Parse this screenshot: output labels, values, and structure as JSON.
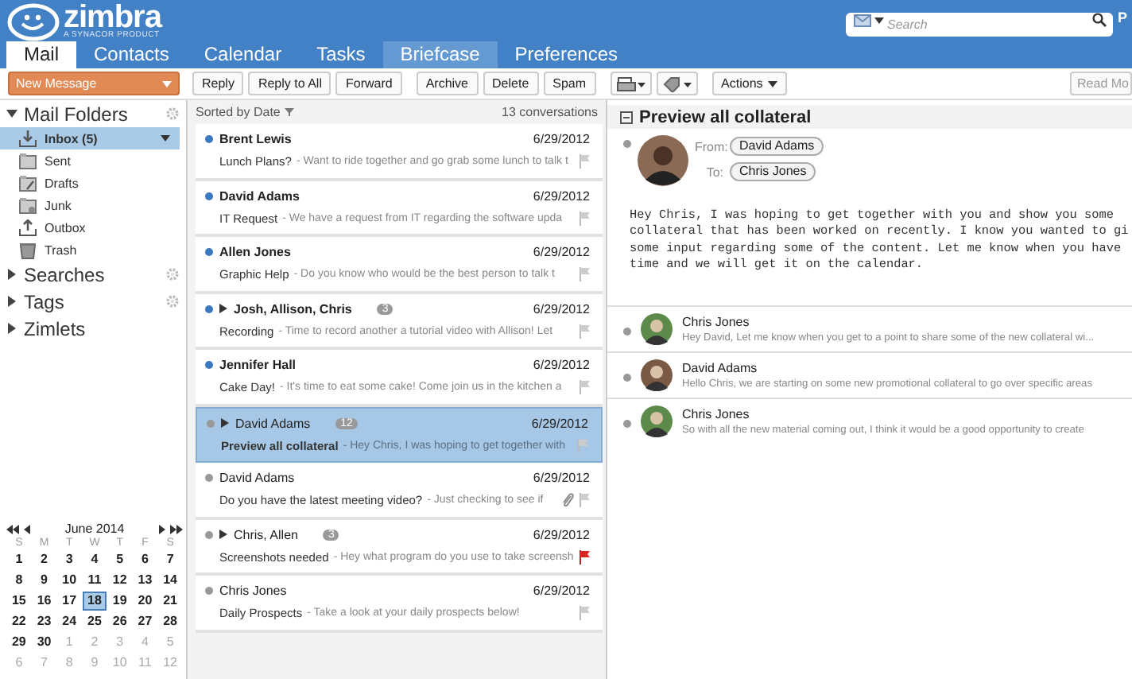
{
  "header": {
    "logo_name": "zimbra",
    "logo_tagline": "A SYNACOR PRODUCT",
    "search": {
      "placeholder": "Search"
    },
    "user_initial": "P"
  },
  "tabs": [
    {
      "label": "Mail",
      "selected": true,
      "hovered": false
    },
    {
      "label": "Contacts",
      "selected": false,
      "hovered": false
    },
    {
      "label": "Calendar",
      "selected": false,
      "hovered": false
    },
    {
      "label": "Tasks",
      "selected": false,
      "hovered": false
    },
    {
      "label": "Briefcase",
      "selected": false,
      "hovered": true
    },
    {
      "label": "Preferences",
      "selected": false,
      "hovered": false
    }
  ],
  "toolbar": {
    "new_message": "New Message",
    "groups": [
      [
        "Reply",
        "Reply to All",
        "Forward"
      ],
      [
        "Archive",
        "Delete",
        "Spam"
      ]
    ],
    "actions": "Actions",
    "read_more": "Read Mo"
  },
  "sidebar": {
    "sections": [
      {
        "label": "Mail Folders",
        "expanded": true,
        "settings": true,
        "items": [
          {
            "label": "Inbox (5)",
            "kind": "inbox",
            "selected": true,
            "unread": true
          },
          {
            "label": "Sent",
            "kind": "sent",
            "selected": false,
            "unread": false
          },
          {
            "label": "Drafts",
            "kind": "drafts",
            "selected": false,
            "unread": false
          },
          {
            "label": "Junk",
            "kind": "junk",
            "selected": false,
            "unread": false
          },
          {
            "label": "Outbox",
            "kind": "outbox",
            "selected": false,
            "unread": false
          },
          {
            "label": "Trash",
            "kind": "trash",
            "selected": false,
            "unread": false
          }
        ]
      },
      {
        "label": "Searches",
        "expanded": false,
        "settings": true
      },
      {
        "label": "Tags",
        "expanded": false,
        "settings": true
      },
      {
        "label": "Zimlets",
        "expanded": false,
        "settings": false
      }
    ]
  },
  "calendar": {
    "month": "June 2014",
    "weekdays": [
      "S",
      "M",
      "T",
      "W",
      "T",
      "F",
      "S"
    ],
    "days": [
      {
        "d": "1",
        "outside": false,
        "selected": false
      },
      {
        "d": "2",
        "outside": false,
        "selected": false
      },
      {
        "d": "3",
        "outside": false,
        "selected": false
      },
      {
        "d": "4",
        "outside": false,
        "selected": false
      },
      {
        "d": "5",
        "outside": false,
        "selected": false
      },
      {
        "d": "6",
        "outside": false,
        "selected": false
      },
      {
        "d": "7",
        "outside": false,
        "selected": false
      },
      {
        "d": "8",
        "outside": false,
        "selected": false
      },
      {
        "d": "9",
        "outside": false,
        "selected": false
      },
      {
        "d": "10",
        "outside": false,
        "selected": false
      },
      {
        "d": "11",
        "outside": false,
        "selected": false
      },
      {
        "d": "12",
        "outside": false,
        "selected": false
      },
      {
        "d": "13",
        "outside": false,
        "selected": false
      },
      {
        "d": "14",
        "outside": false,
        "selected": false
      },
      {
        "d": "15",
        "outside": false,
        "selected": false
      },
      {
        "d": "16",
        "outside": false,
        "selected": false
      },
      {
        "d": "17",
        "outside": false,
        "selected": false
      },
      {
        "d": "18",
        "outside": false,
        "selected": true
      },
      {
        "d": "19",
        "outside": false,
        "selected": false
      },
      {
        "d": "20",
        "outside": false,
        "selected": false
      },
      {
        "d": "21",
        "outside": false,
        "selected": false
      },
      {
        "d": "22",
        "outside": false,
        "selected": false
      },
      {
        "d": "23",
        "outside": false,
        "selected": false
      },
      {
        "d": "24",
        "outside": false,
        "selected": false
      },
      {
        "d": "25",
        "outside": false,
        "selected": false
      },
      {
        "d": "26",
        "outside": false,
        "selected": false
      },
      {
        "d": "27",
        "outside": false,
        "selected": false
      },
      {
        "d": "28",
        "outside": false,
        "selected": false
      },
      {
        "d": "29",
        "outside": false,
        "selected": false
      },
      {
        "d": "30",
        "outside": false,
        "selected": false
      },
      {
        "d": "1",
        "outside": true,
        "selected": false
      },
      {
        "d": "2",
        "outside": true,
        "selected": false
      },
      {
        "d": "3",
        "outside": true,
        "selected": false
      },
      {
        "d": "4",
        "outside": true,
        "selected": false
      },
      {
        "d": "5",
        "outside": true,
        "selected": false
      },
      {
        "d": "6",
        "outside": true,
        "selected": false
      },
      {
        "d": "7",
        "outside": true,
        "selected": false
      },
      {
        "d": "8",
        "outside": true,
        "selected": false
      },
      {
        "d": "9",
        "outside": true,
        "selected": false
      },
      {
        "d": "10",
        "outside": true,
        "selected": false
      },
      {
        "d": "11",
        "outside": true,
        "selected": false
      },
      {
        "d": "12",
        "outside": true,
        "selected": false
      }
    ]
  },
  "message_list": {
    "sort_label": "Sorted by Date",
    "count": "13 conversations",
    "items": [
      {
        "from": "Brent Lewis",
        "date": "6/29/2012",
        "subject": "Lunch Plans?",
        "snippet": "- Want to ride together and go grab some lunch to talk t",
        "unread": true,
        "selected": false,
        "thread": false,
        "flagged": false,
        "attachment": false
      },
      {
        "from": "David Adams",
        "date": "6/29/2012",
        "subject": "IT Request",
        "snippet": "- We have a request from IT regarding the software upda",
        "unread": true,
        "selected": false,
        "thread": false,
        "flagged": false,
        "attachment": false
      },
      {
        "from": "Allen Jones",
        "date": "6/29/2012",
        "subject": "Graphic Help",
        "snippet": "- Do you know who would be the best person to talk t",
        "unread": true,
        "selected": false,
        "thread": false,
        "flagged": false,
        "attachment": false
      },
      {
        "from": "Josh, Allison, Chris",
        "count": "3",
        "date": "6/29/2012",
        "subject": "Recording",
        "snippet": "- Time to record another a tutorial video with Allison! Let",
        "unread": true,
        "selected": false,
        "thread": true,
        "flagged": false,
        "attachment": false
      },
      {
        "from": "Jennifer Hall",
        "date": "6/29/2012",
        "subject": "Cake Day!",
        "snippet": "- It's time to eat some cake! Come join us in the kitchen a",
        "unread": true,
        "selected": false,
        "thread": false,
        "flagged": false,
        "attachment": false
      },
      {
        "from": "David Adams",
        "count": "12",
        "date": "6/29/2012",
        "subject": "Preview all collateral",
        "snippet": "- Hey Chris, I was hoping to get together with",
        "unread": false,
        "selected": true,
        "thread": true,
        "flagged": false,
        "attachment": false
      },
      {
        "from": "David Adams",
        "date": "6/29/2012",
        "subject": "Do you have the latest meeting video?",
        "snippet": "- Just checking to see if",
        "unread": false,
        "selected": false,
        "thread": false,
        "flagged": false,
        "attachment": true
      },
      {
        "from": "Chris, Allen",
        "count": "3",
        "date": "6/29/2012",
        "subject": "Screenshots needed",
        "snippet": "- Hey what program do you use to take screensh",
        "unread": false,
        "selected": false,
        "thread": true,
        "flagged": true,
        "attachment": false
      },
      {
        "from": "Chris Jones",
        "date": "6/29/2012",
        "subject": "Daily Prospects",
        "snippet": "- Take a look at your daily prospects below!",
        "unread": false,
        "selected": false,
        "thread": false,
        "flagged": false,
        "attachment": false
      }
    ]
  },
  "reading_pane": {
    "title": "Preview all collateral",
    "from_label": "From:",
    "from": "David Adams",
    "to_label": "To:",
    "to": "Chris Jones",
    "body": [
      "Hey Chris, I was hoping to get together with you and show you some",
      "collateral that has been worked on recently. I know you wanted to gi",
      "some input regarding some of the content. Let me know when you have",
      "time and we will get it on the calendar."
    ],
    "replies": [
      {
        "from": "Chris Jones",
        "snippet": "Hey David, Let me know when you get to a point to share some of the new collateral wi..."
      },
      {
        "from": "David Adams",
        "snippet": "Hello Chris, we are starting on some new promotional collateral to go over specific areas"
      },
      {
        "from": "Chris Jones",
        "snippet": "So with all the new material coming out, I think it would be a good opportunity to create"
      }
    ]
  }
}
